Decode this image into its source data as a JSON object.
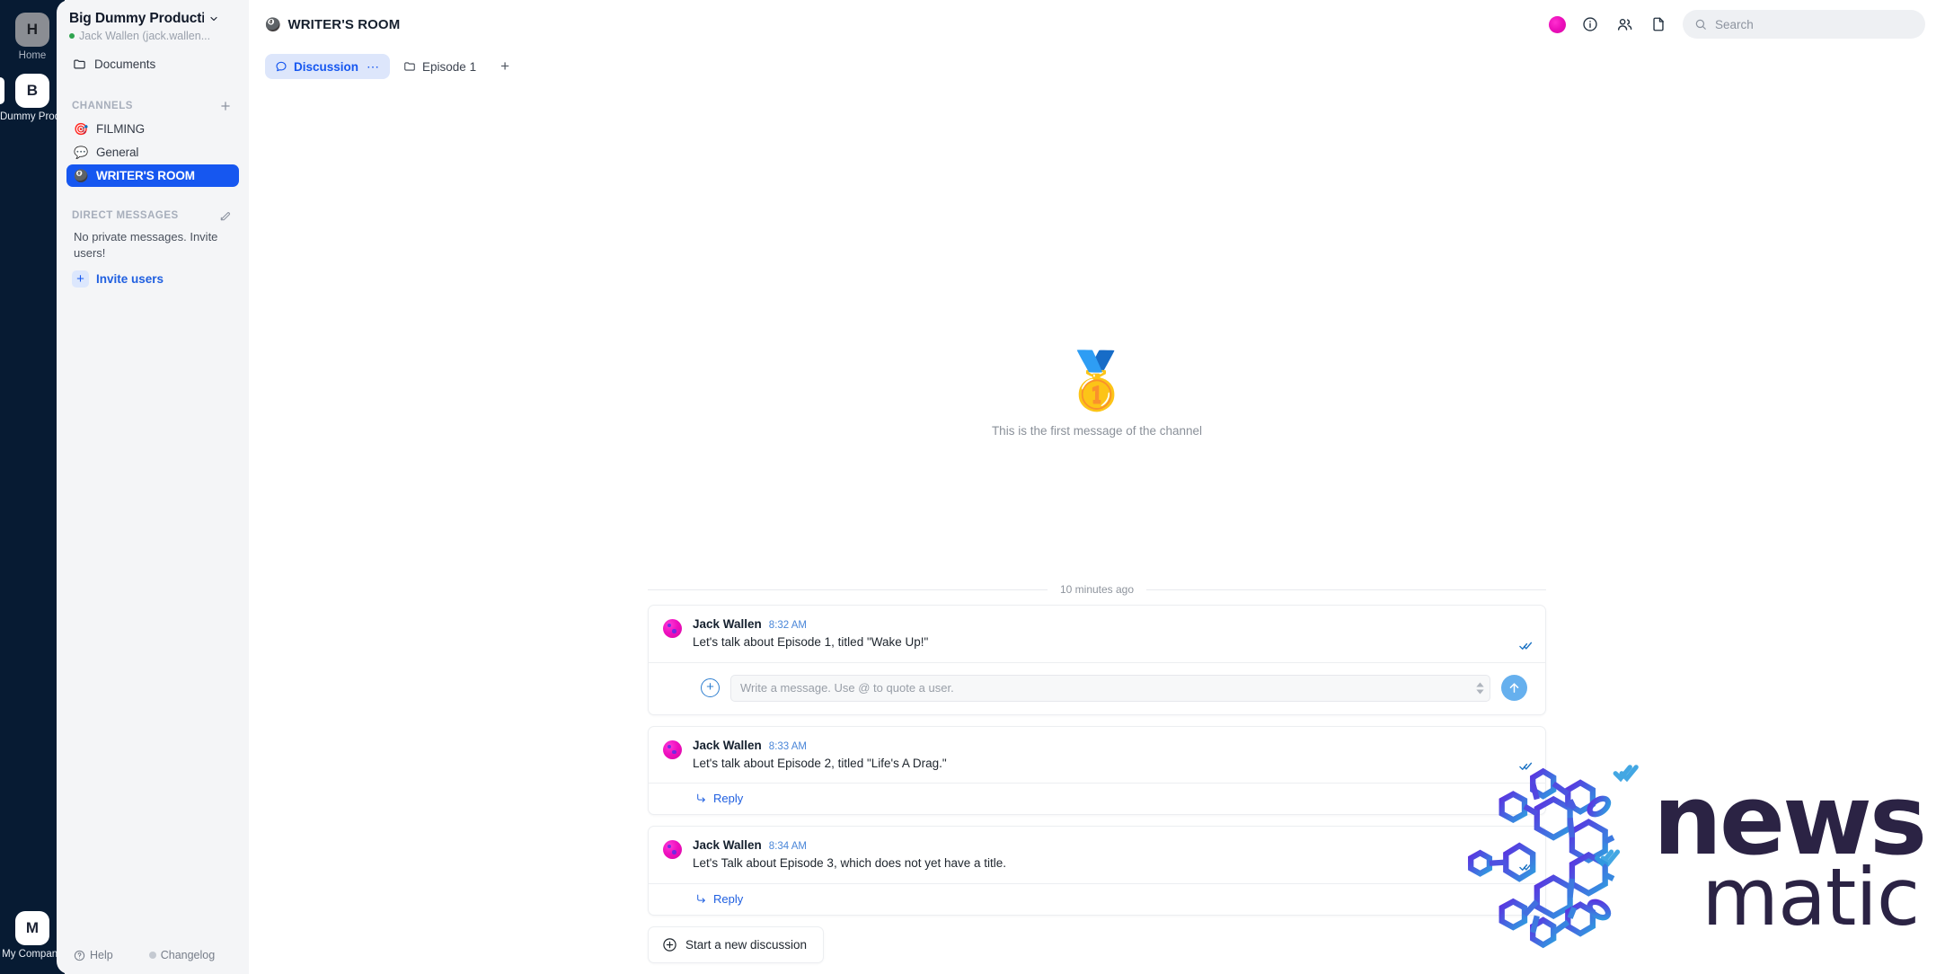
{
  "rail": {
    "items": [
      {
        "initial": "H",
        "label": "Home",
        "selected": false
      },
      {
        "initial": "B",
        "label": "Dummy Produc",
        "selected": true
      }
    ],
    "bottom": {
      "initial": "M",
      "label": "My Company"
    }
  },
  "sidebar": {
    "workspace_title": "Big Dummy Producti...",
    "user_line": "Jack Wallen (jack.wallen...",
    "documents_label": "Documents",
    "channels_heading": "CHANNELS",
    "channels": [
      {
        "emoji": "🎯",
        "icon_name": "dart-icon",
        "label": "FILMING",
        "active": false
      },
      {
        "emoji": "💬",
        "icon_name": "speech-balloon-icon",
        "label": "General",
        "active": false
      },
      {
        "emoji": "🎱",
        "icon_name": "pool-8-ball-icon",
        "label": "WRITER'S ROOM",
        "active": true
      }
    ],
    "dm_heading": "DIRECT MESSAGES",
    "dm_empty": "No private messages. Invite users!",
    "invite_label": "Invite users",
    "footer": {
      "help": "Help",
      "changelog": "Changelog"
    }
  },
  "topbar": {
    "channel_emoji": "🎱",
    "channel_title": "WRITER'S ROOM",
    "search_placeholder": "Search"
  },
  "tabs": [
    {
      "label": "Discussion",
      "icon": "chat-bubble-icon",
      "active": true,
      "has_menu": true
    },
    {
      "label": "Episode 1",
      "icon": "folder-icon",
      "active": false,
      "has_menu": false
    }
  ],
  "tab_add_label": "+",
  "empty_state": {
    "emoji": "🥇",
    "icon_name": "first-place-medal-icon",
    "text": "This is the first message of the channel"
  },
  "day_separator": "10 minutes ago",
  "messages": [
    {
      "author": "Jack Wallen",
      "time": "8:32 AM",
      "text": "Let's talk about Episode 1, titled \"Wake Up!\"",
      "read": true,
      "has_composer": true,
      "has_reply": false
    },
    {
      "author": "Jack Wallen",
      "time": "8:33 AM",
      "text": "Let's talk about Episode 2, titled \"Life's A Drag.\"",
      "read": true,
      "has_composer": false,
      "has_reply": true
    },
    {
      "author": "Jack Wallen",
      "time": "8:34 AM",
      "text": "Let's Talk about Episode 3, which does not yet have a title.",
      "read": true,
      "has_composer": false,
      "has_reply": true
    }
  ],
  "composer": {
    "placeholder": "Write a message. Use @ to quote a user."
  },
  "reply_label": "Reply",
  "new_discussion_label": "Start a new discussion",
  "watermark": {
    "word1": "news",
    "word2": "matic"
  },
  "colors": {
    "accent_blue": "#1657f0",
    "rail_navy": "#071b33",
    "sidebar_bg": "#f4f5f7",
    "avatar_pink": "#ef10bf",
    "online_green": "#2ea44f",
    "tick_blue": "#1e74c4",
    "send_blue": "#66b0ee"
  }
}
